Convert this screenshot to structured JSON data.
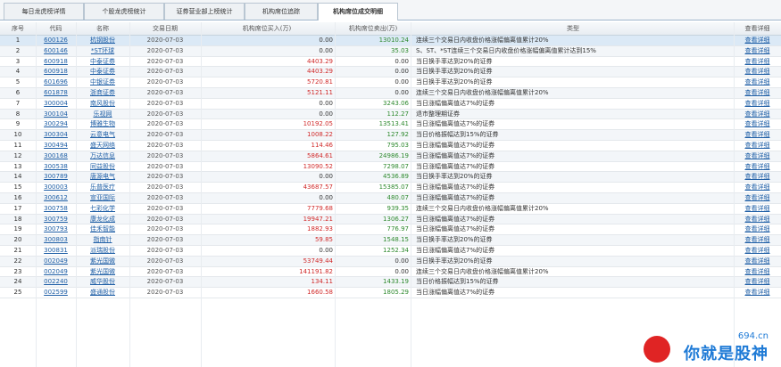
{
  "tabs": [
    {
      "label": "每日龙虎榜详情",
      "active": false
    },
    {
      "label": "个股龙虎榜统计",
      "active": false
    },
    {
      "label": "证券营业部上榜统计",
      "active": false
    },
    {
      "label": "机构席位追踪",
      "active": false
    },
    {
      "label": "机构席位成交明细",
      "active": true
    }
  ],
  "table": {
    "headers": {
      "seq": "序号",
      "code": "代码",
      "name": "名称",
      "date": "交易日期",
      "buy": "机构席位买入(万)",
      "sell": "机构席位卖出(万)",
      "type": "类型",
      "link": "查看详细"
    },
    "selected_row": 1,
    "rows": [
      {
        "seq": "1",
        "code": "600126",
        "name": "杭钢股份",
        "date": "2020-07-03",
        "buy": "0.00",
        "sell": "13010.24",
        "type": "连续三个交易日内收盘价格涨幅偏离值累计20%",
        "link": "查看详细"
      },
      {
        "seq": "2",
        "code": "600146",
        "name": "*ST环球",
        "date": "2020-07-03",
        "buy": "0.00",
        "sell": "35.03",
        "type": "S、ST、*ST连续三个交易日内收盘价格涨幅偏离值累计达到15%",
        "link": "查看详细"
      },
      {
        "seq": "3",
        "code": "600918",
        "name": "中泰证券",
        "date": "2020-07-03",
        "buy": "4403.29",
        "sell": "0.00",
        "type": "当日换手率达到20%的证券",
        "link": "查看详细"
      },
      {
        "seq": "4",
        "code": "600918",
        "name": "中泰证券",
        "date": "2020-07-03",
        "buy": "4403.29",
        "sell": "0.00",
        "type": "当日换手率达到20%的证券",
        "link": "查看详细"
      },
      {
        "seq": "5",
        "code": "601696",
        "name": "中银证券",
        "date": "2020-07-03",
        "buy": "5720.81",
        "sell": "0.00",
        "type": "当日换手率达到20%的证券",
        "link": "查看详细"
      },
      {
        "seq": "6",
        "code": "601878",
        "name": "浙商证券",
        "date": "2020-07-03",
        "buy": "5121.11",
        "sell": "0.00",
        "type": "连续三个交易日内收盘价格涨幅偏离值累计20%",
        "link": "查看详细"
      },
      {
        "seq": "7",
        "code": "300004",
        "name": "南风股份",
        "date": "2020-07-03",
        "buy": "0.00",
        "sell": "3243.06",
        "type": "当日涨幅偏离值达7%的证券",
        "link": "查看详细"
      },
      {
        "seq": "8",
        "code": "300104",
        "name": "乐视网",
        "date": "2020-07-03",
        "buy": "0.00",
        "sell": "112.27",
        "type": "退市整理期证券",
        "link": "查看详细"
      },
      {
        "seq": "9",
        "code": "300294",
        "name": "博雅生物",
        "date": "2020-07-03",
        "buy": "10192.05",
        "sell": "13513.41",
        "type": "当日涨幅偏离值达7%的证券",
        "link": "查看详细"
      },
      {
        "seq": "10",
        "code": "300304",
        "name": "云意电气",
        "date": "2020-07-03",
        "buy": "1008.22",
        "sell": "127.92",
        "type": "当日价格振幅达到15%的证券",
        "link": "查看详细"
      },
      {
        "seq": "11",
        "code": "300494",
        "name": "盛天网络",
        "date": "2020-07-03",
        "buy": "114.46",
        "sell": "795.03",
        "type": "当日涨幅偏离值达7%的证券",
        "link": "查看详细"
      },
      {
        "seq": "12",
        "code": "300168",
        "name": "万达信息",
        "date": "2020-07-03",
        "buy": "5864.61",
        "sell": "24986.19",
        "type": "当日涨幅偏离值达7%的证券",
        "link": "查看详细"
      },
      {
        "seq": "13",
        "code": "300538",
        "name": "同益股份",
        "date": "2020-07-03",
        "buy": "13090.52",
        "sell": "7298.07",
        "type": "当日涨幅偏离值达7%的证券",
        "link": "查看详细"
      },
      {
        "seq": "14",
        "code": "300789",
        "name": "唐源电气",
        "date": "2020-07-03",
        "buy": "0.00",
        "sell": "4536.89",
        "type": "当日换手率达到20%的证券",
        "link": "查看详细"
      },
      {
        "seq": "15",
        "code": "300003",
        "name": "乐普医疗",
        "date": "2020-07-03",
        "buy": "43687.57",
        "sell": "15385.07",
        "type": "当日涨幅偏离值达7%的证券",
        "link": "查看详细"
      },
      {
        "seq": "16",
        "code": "300612",
        "name": "宣亚国际",
        "date": "2020-07-03",
        "buy": "0.00",
        "sell": "480.07",
        "type": "当日涨幅偏离值达7%的证券",
        "link": "查看详细"
      },
      {
        "seq": "17",
        "code": "300758",
        "name": "七彩化学",
        "date": "2020-07-03",
        "buy": "7779.68",
        "sell": "939.35",
        "type": "连续三个交易日内收盘价格涨幅偏离值累计20%",
        "link": "查看详细"
      },
      {
        "seq": "18",
        "code": "300759",
        "name": "康龙化成",
        "date": "2020-07-03",
        "buy": "19947.21",
        "sell": "1306.27",
        "type": "当日涨幅偏离值达7%的证券",
        "link": "查看详细"
      },
      {
        "seq": "19",
        "code": "300793",
        "name": "佳禾智能",
        "date": "2020-07-03",
        "buy": "1882.93",
        "sell": "776.97",
        "type": "当日涨幅偏离值达7%的证券",
        "link": "查看详细"
      },
      {
        "seq": "20",
        "code": "300803",
        "name": "指南针",
        "date": "2020-07-03",
        "buy": "59.85",
        "sell": "1548.15",
        "type": "当日换手率达到20%的证券",
        "link": "查看详细"
      },
      {
        "seq": "21",
        "code": "300831",
        "name": "派瑞股份",
        "date": "2020-07-03",
        "buy": "0.00",
        "sell": "1252.34",
        "type": "当日涨幅偏离值达7%的证券",
        "link": "查看详细"
      },
      {
        "seq": "22",
        "code": "002049",
        "name": "紫光国微",
        "date": "2020-07-03",
        "buy": "53749.44",
        "sell": "0.00",
        "type": "当日换手率达到20%的证券",
        "link": "查看详细"
      },
      {
        "seq": "23",
        "code": "002049",
        "name": "紫光国微",
        "date": "2020-07-03",
        "buy": "141191.82",
        "sell": "0.00",
        "type": "连续三个交易日内收盘价格涨幅偏离值累计20%",
        "link": "查看详细"
      },
      {
        "seq": "24",
        "code": "002240",
        "name": "威华股份",
        "date": "2020-07-03",
        "buy": "134.11",
        "sell": "1433.19",
        "type": "当日价格振幅达到15%的证券",
        "link": "查看详细"
      },
      {
        "seq": "25",
        "code": "002599",
        "name": "盛通股份",
        "date": "2020-07-03",
        "buy": "1660.58",
        "sell": "1805.29",
        "type": "当日涨幅偏离值达7%的证券",
        "link": "查看详细"
      }
    ]
  },
  "watermark": {
    "text": "你就是股神",
    "site": "694.cn",
    "logo_color": "#e02424",
    "text_color": "#1e7ad6"
  }
}
